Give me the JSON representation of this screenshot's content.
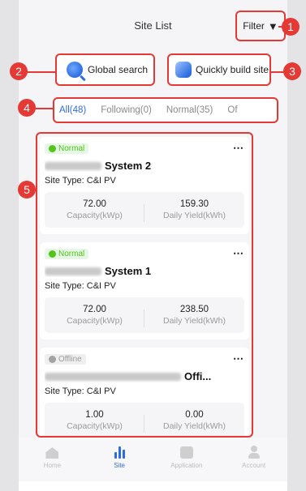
{
  "header": {
    "title": "Site List",
    "filter_label": "Filter"
  },
  "quick_actions": {
    "global_search": "Global search",
    "quick_build": "Quickly build site"
  },
  "tabs": [
    {
      "label": "All(48)",
      "active": true
    },
    {
      "label": "Following(0)",
      "active": false
    },
    {
      "label": "Normal(35)",
      "active": false
    },
    {
      "label": "Of",
      "active": false
    }
  ],
  "sites": [
    {
      "status": "Normal",
      "name": "System 2",
      "site_type": "Site Type: C&I PV",
      "capacity_value": "72.00",
      "capacity_label": "Capacity(kWp)",
      "yield_value": "159.30",
      "yield_label": "Daily Yield(kWh)"
    },
    {
      "status": "Normal",
      "name": "System 1",
      "site_type": "Site Type: C&I PV",
      "capacity_value": "72.00",
      "capacity_label": "Capacity(kWp)",
      "yield_value": "238.50",
      "yield_label": "Daily Yield(kWh)"
    },
    {
      "status": "Offline",
      "name": "Offi...",
      "site_type": "Site Type: C&I PV",
      "capacity_value": "1.00",
      "capacity_label": "Capacity(kWp)",
      "yield_value": "0.00",
      "yield_label": "Daily Yield(kWh)"
    }
  ],
  "tabbar": [
    {
      "label": "Home",
      "active": false
    },
    {
      "label": "Site",
      "active": true
    },
    {
      "label": "Application",
      "active": false
    },
    {
      "label": "Account",
      "active": false
    }
  ],
  "callouts": [
    "1",
    "2",
    "3",
    "4",
    "5"
  ],
  "colors": {
    "accent": "#2f6be3",
    "callout": "#e53935",
    "normal": "#52c41a",
    "offline": "#a3a3a3"
  },
  "more_icon": "⋯"
}
